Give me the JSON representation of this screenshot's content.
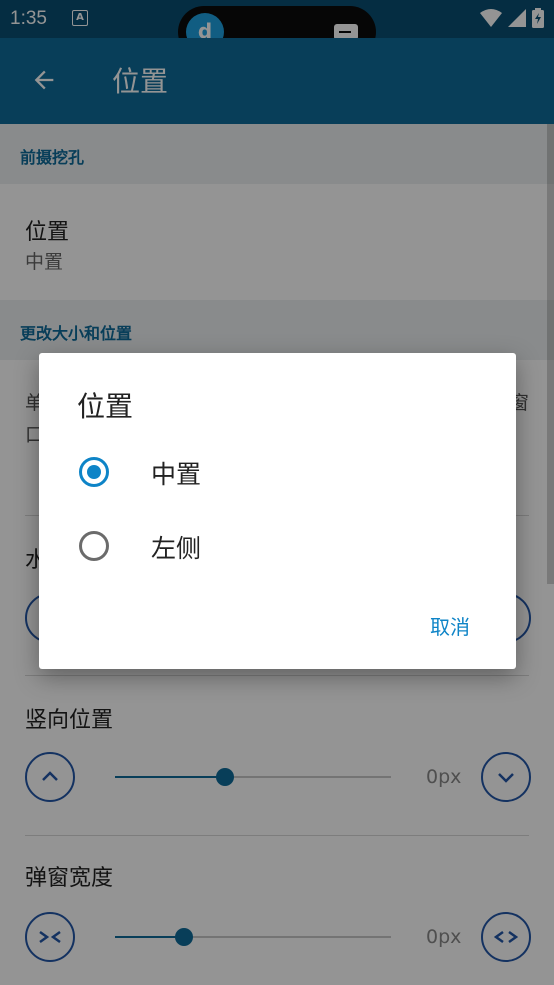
{
  "status": {
    "time": "1:35",
    "notif_letter": "A"
  },
  "appbar": {
    "title": "位置"
  },
  "sections": {
    "front_camera": "前摄挖孔",
    "resize": "更改大小和位置"
  },
  "position_pref": {
    "title": "位置",
    "value": "中置"
  },
  "partial": {
    "left_line1": "单",
    "left_line2": "口",
    "right_line1": "窗",
    "horizontal": "水"
  },
  "vertical": {
    "title": "竖向位置",
    "value": "0px",
    "level": 0.4
  },
  "width": {
    "title": "弹窗宽度",
    "value": "0px",
    "level": 0.25
  },
  "dialog": {
    "title": "位置",
    "options": [
      {
        "label": "中置",
        "selected": true
      },
      {
        "label": "左侧",
        "selected": false
      }
    ],
    "cancel": "取消"
  },
  "colors": {
    "primary": "#0e6c9a",
    "accent": "#0e84c7",
    "button_outline": "#2457a8"
  }
}
